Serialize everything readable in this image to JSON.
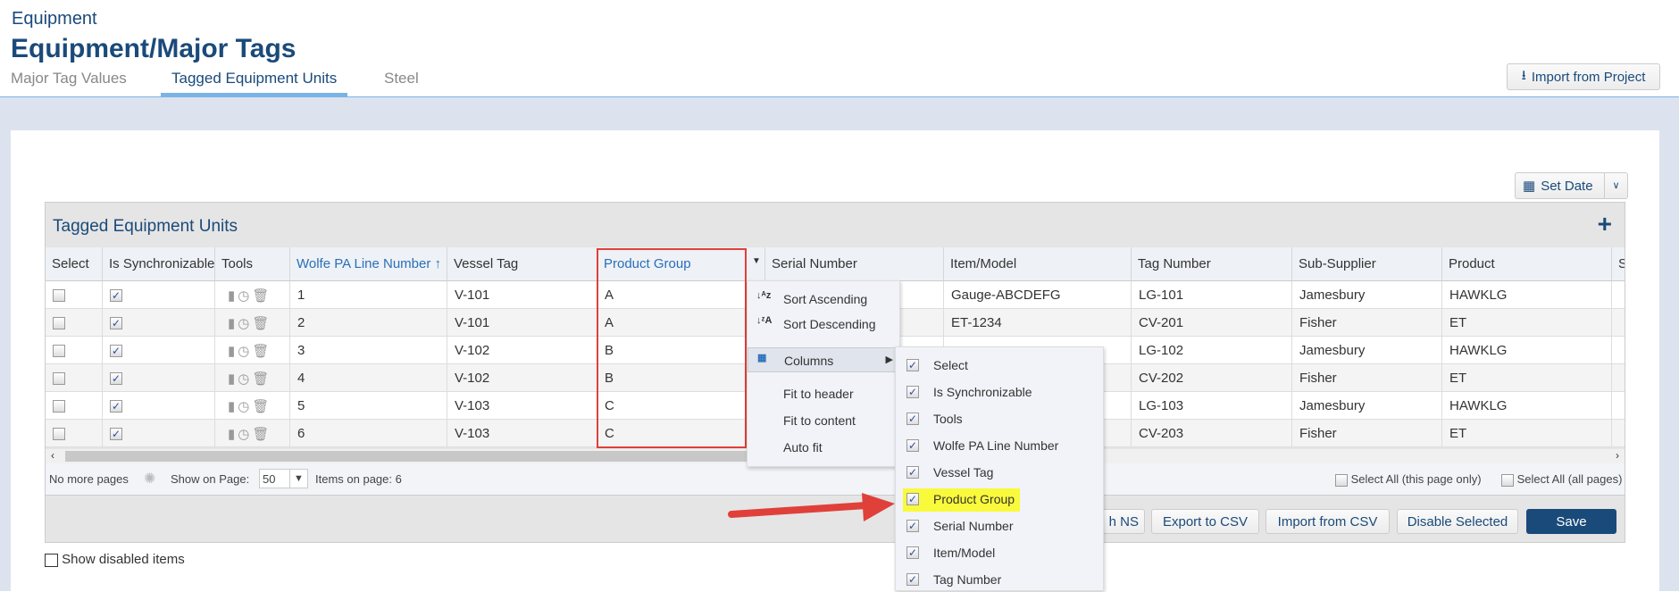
{
  "header": {
    "breadcrumb": "Equipment",
    "title": "Equipment/Major Tags",
    "import_button": "Import from Project"
  },
  "tabs": [
    {
      "label": "Major Tag Values",
      "active": false
    },
    {
      "label": "Tagged Equipment Units",
      "active": true
    },
    {
      "label": "Steel",
      "active": false
    }
  ],
  "toolbar": {
    "set_date": "Set Date"
  },
  "grid": {
    "title": "Tagged Equipment Units",
    "columns": [
      "Select",
      "Is Synchronizable",
      "Tools",
      "Wolfe PA Line Number ↑",
      "Vessel Tag",
      "Product Group",
      "Serial Number",
      "Item/Model",
      "Tag Number",
      "Sub-Supplier",
      "Product",
      "S"
    ],
    "rows": [
      {
        "line": "1",
        "vessel": "V-101",
        "group": "A",
        "serial": "",
        "model": "Gauge-ABCDEFG",
        "tag": "LG-101",
        "supplier": "Jamesbury",
        "product": "HAWKLG"
      },
      {
        "line": "2",
        "vessel": "V-101",
        "group": "A",
        "serial": "",
        "model": "ET-1234",
        "tag": "CV-201",
        "supplier": "Fisher",
        "product": "ET"
      },
      {
        "line": "3",
        "vessel": "V-102",
        "group": "B",
        "serial": "",
        "model": "",
        "tag": "LG-102",
        "supplier": "Jamesbury",
        "product": "HAWKLG"
      },
      {
        "line": "4",
        "vessel": "V-102",
        "group": "B",
        "serial": "",
        "model": "",
        "tag": "CV-202",
        "supplier": "Fisher",
        "product": "ET"
      },
      {
        "line": "5",
        "vessel": "V-103",
        "group": "C",
        "serial": "",
        "model": "",
        "tag": "LG-103",
        "supplier": "Jamesbury",
        "product": "HAWKLG"
      },
      {
        "line": "6",
        "vessel": "V-103",
        "group": "C",
        "serial": "",
        "model": "",
        "tag": "CV-203",
        "supplier": "Fisher",
        "product": "ET"
      }
    ],
    "footer": {
      "no_more": "No more pages",
      "show_on_page": "Show on Page:",
      "page_size": "50",
      "items_on_page": "Items on page: 6",
      "select_all_page": "Select All (this page only)",
      "select_all_all": "Select All (all pages)"
    }
  },
  "actions": {
    "sync_ns_partial": "h NS",
    "export": "Export to CSV",
    "import": "Import from CSV",
    "disable": "Disable Selected",
    "save": "Save"
  },
  "show_disabled": "Show disabled items",
  "context_menu": {
    "items": [
      "Sort Ascending",
      "Sort Descending",
      "Columns",
      "Fit to header",
      "Fit to content",
      "Auto fit"
    ]
  },
  "columns_menu": {
    "items": [
      "Select",
      "Is Synchronizable",
      "Tools",
      "Wolfe PA Line Number",
      "Vessel Tag",
      "Product Group",
      "Serial Number",
      "Item/Model",
      "Tag Number"
    ],
    "highlighted": "Product Group"
  },
  "colors": {
    "brand": "#1a4a7a",
    "link": "#2a6fb8",
    "highlight": "#fafa3c",
    "annotation": "#e0403a"
  }
}
